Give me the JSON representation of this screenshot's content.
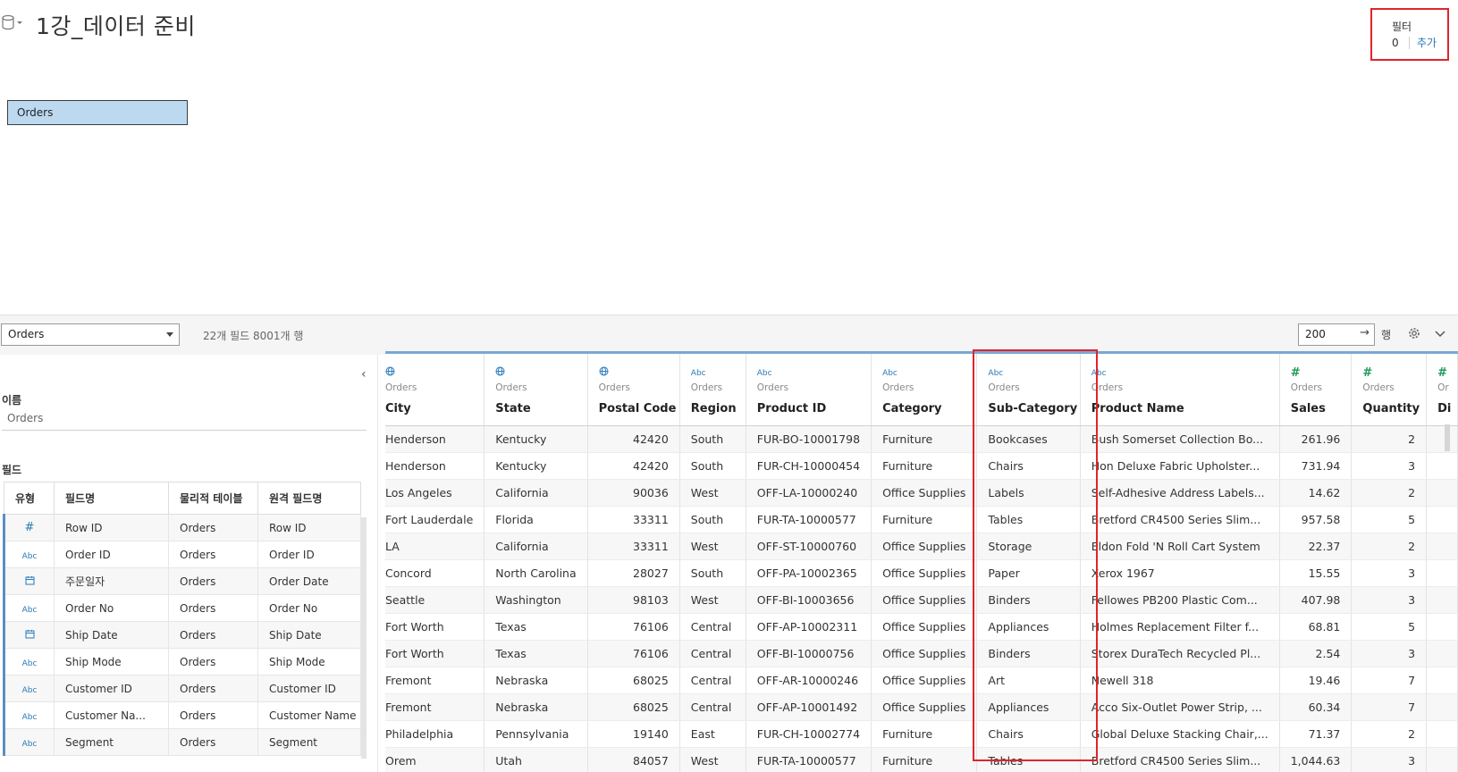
{
  "header": {
    "title": "1강_데이터 준비",
    "datasource_icon": "database-icon",
    "filter": {
      "label": "필터",
      "count": "0",
      "add_label": "추가"
    }
  },
  "canvas": {
    "table_pill": "Orders"
  },
  "toolbar": {
    "table_select": "Orders",
    "info": "22개 필드 8001개 행",
    "rows_value": "200",
    "rows_arrow": "→",
    "rows_label": "행",
    "settings_icon": "gear-icon",
    "expand_icon": "chevron-down-icon"
  },
  "left_panel": {
    "collapse_icon": "‹",
    "name_label": "이름",
    "name_value": "Orders",
    "fields_label": "필드",
    "columns": [
      "유형",
      "필드명",
      "물리적 테이블",
      "원격 필드명"
    ],
    "rows": [
      {
        "type": "#",
        "field": "Row ID",
        "table": "Orders",
        "remote": "Row ID"
      },
      {
        "type": "Abc",
        "field": "Order ID",
        "table": "Orders",
        "remote": "Order ID"
      },
      {
        "type": "cal",
        "field": "주문일자",
        "table": "Orders",
        "remote": "Order Date"
      },
      {
        "type": "Abc",
        "field": "Order No",
        "table": "Orders",
        "remote": "Order No"
      },
      {
        "type": "cal",
        "field": "Ship Date",
        "table": "Orders",
        "remote": "Ship Date"
      },
      {
        "type": "Abc",
        "field": "Ship Mode",
        "table": "Orders",
        "remote": "Ship Mode"
      },
      {
        "type": "Abc",
        "field": "Customer ID",
        "table": "Orders",
        "remote": "Customer ID"
      },
      {
        "type": "Abc",
        "field": "Customer Na...",
        "table": "Orders",
        "remote": "Customer Name"
      },
      {
        "type": "Abc",
        "field": "Segment",
        "table": "Orders",
        "remote": "Segment"
      }
    ]
  },
  "grid": {
    "columns": [
      {
        "icon": "globe",
        "source": "Orders",
        "name": "City"
      },
      {
        "icon": "globe",
        "source": "Orders",
        "name": "State"
      },
      {
        "icon": "globe",
        "source": "Orders",
        "name": "Postal Code"
      },
      {
        "icon": "Abc",
        "source": "Orders",
        "name": "Region"
      },
      {
        "icon": "Abc",
        "source": "Orders",
        "name": "Product ID"
      },
      {
        "icon": "Abc",
        "source": "Orders",
        "name": "Category"
      },
      {
        "icon": "Abc",
        "source": "Orders",
        "name": "Sub-Category"
      },
      {
        "icon": "Abc",
        "source": "Orders",
        "name": "Product Name"
      },
      {
        "icon": "#",
        "source": "Orders",
        "name": "Sales"
      },
      {
        "icon": "#",
        "source": "Orders",
        "name": "Quantity"
      },
      {
        "icon": "#",
        "source": "Or",
        "name": "Di"
      }
    ],
    "rows": [
      [
        "Henderson",
        "Kentucky",
        "42420",
        "South",
        "FUR-BO-10001798",
        "Furniture",
        "Bookcases",
        "Bush Somerset Collection Bo...",
        "261.96",
        "2"
      ],
      [
        "Henderson",
        "Kentucky",
        "42420",
        "South",
        "FUR-CH-10000454",
        "Furniture",
        "Chairs",
        "Hon Deluxe Fabric Upholster...",
        "731.94",
        "3"
      ],
      [
        "Los Angeles",
        "California",
        "90036",
        "West",
        "OFF-LA-10000240",
        "Office Supplies",
        "Labels",
        "Self-Adhesive Address Labels...",
        "14.62",
        "2"
      ],
      [
        "Fort Lauderdale",
        "Florida",
        "33311",
        "South",
        "FUR-TA-10000577",
        "Furniture",
        "Tables",
        "Bretford CR4500 Series Slim...",
        "957.58",
        "5"
      ],
      [
        "LA",
        "California",
        "33311",
        "West",
        "OFF-ST-10000760",
        "Office Supplies",
        "Storage",
        "Eldon Fold 'N Roll Cart System",
        "22.37",
        "2"
      ],
      [
        "Concord",
        "North Carolina",
        "28027",
        "South",
        "OFF-PA-10002365",
        "Office Supplies",
        "Paper",
        "Xerox 1967",
        "15.55",
        "3"
      ],
      [
        "Seattle",
        "Washington",
        "98103",
        "West",
        "OFF-BI-10003656",
        "Office Supplies",
        "Binders",
        "Fellowes PB200 Plastic Com...",
        "407.98",
        "3"
      ],
      [
        "Fort Worth",
        "Texas",
        "76106",
        "Central",
        "OFF-AP-10002311",
        "Office Supplies",
        "Appliances",
        "Holmes Replacement Filter f...",
        "68.81",
        "5"
      ],
      [
        "Fort Worth",
        "Texas",
        "76106",
        "Central",
        "OFF-BI-10000756",
        "Office Supplies",
        "Binders",
        "Storex DuraTech Recycled Pl...",
        "2.54",
        "3"
      ],
      [
        "Fremont",
        "Nebraska",
        "68025",
        "Central",
        "OFF-AR-10000246",
        "Office Supplies",
        "Art",
        "Newell 318",
        "19.46",
        "7"
      ],
      [
        "Fremont",
        "Nebraska",
        "68025",
        "Central",
        "OFF-AP-10001492",
        "Office Supplies",
        "Appliances",
        "Acco Six-Outlet Power Strip, ...",
        "60.34",
        "7"
      ],
      [
        "Philadelphia",
        "Pennsylvania",
        "19140",
        "East",
        "FUR-CH-10002774",
        "Furniture",
        "Chairs",
        "Global Deluxe Stacking Chair,...",
        "71.37",
        "2"
      ],
      [
        "Orem",
        "Utah",
        "84057",
        "West",
        "FUR-TA-10000577",
        "Furniture",
        "Tables",
        "Bretford CR4500 Series Slim...",
        "1,044.63",
        "3"
      ]
    ]
  }
}
